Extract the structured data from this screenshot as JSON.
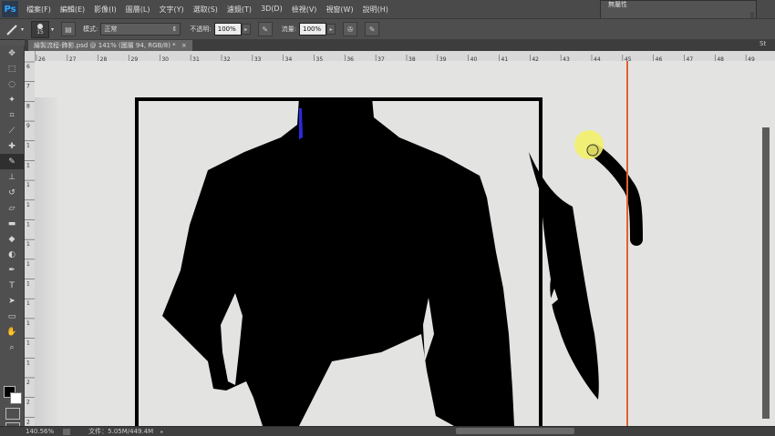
{
  "app": {
    "logo": "Ps"
  },
  "menu": {
    "items": [
      "檔案(F)",
      "編輯(E)",
      "影像(I)",
      "圖層(L)",
      "文字(Y)",
      "選取(S)",
      "濾鏡(T)",
      "3D(D)",
      "檢視(V)",
      "視窗(W)",
      "說明(H)"
    ]
  },
  "options": {
    "brush_size": "15",
    "mode_label": "模式:",
    "mode_value": "正常",
    "opacity_label": "不透明:",
    "opacity_value": "100%",
    "flow_label": "流量:",
    "flow_value": "100%"
  },
  "document": {
    "tab_title": "繪製流程-飾影.psd @ 141% (圖層 94, RGB/8) *",
    "close_glyph": "×"
  },
  "ruler": {
    "top_ticks": [
      "26",
      "27",
      "28",
      "29",
      "30",
      "31",
      "32",
      "33",
      "34",
      "35",
      "36",
      "37",
      "38",
      "39",
      "40",
      "41",
      "42",
      "43",
      "44",
      "45",
      "46",
      "47",
      "48",
      "49"
    ],
    "left_ticks": [
      "6",
      "7",
      "8",
      "9",
      "1",
      "1",
      "1",
      "1",
      "1",
      "1",
      "1",
      "1",
      "1",
      "1",
      "1",
      "1",
      "2",
      "2",
      "2"
    ]
  },
  "status": {
    "zoom": "140.56%",
    "doc_info": "文件：5.05M/449.4M"
  },
  "panel": {
    "title": "無屬性"
  },
  "misc": {
    "right_edge_label": "St"
  },
  "colors": {
    "foreground": "#000000",
    "background": "#ffffff",
    "guide": "#e0622f",
    "highlight": "#f2ef6a"
  },
  "icons": {
    "tools": [
      "move-icon",
      "marquee-icon",
      "lasso-icon",
      "quick-select-icon",
      "crop-icon",
      "eyedropper-icon",
      "healing-icon",
      "brush-icon",
      "clone-stamp-icon",
      "history-brush-icon",
      "eraser-icon",
      "gradient-icon",
      "blur-icon",
      "dodge-icon",
      "pen-icon",
      "type-icon",
      "path-select-icon",
      "shape-icon",
      "hand-icon",
      "zoom-icon"
    ]
  }
}
